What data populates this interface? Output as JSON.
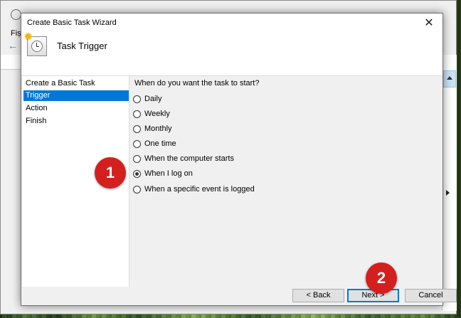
{
  "background_window": {
    "menu_label": "Fiș"
  },
  "dialog": {
    "title": "Create Basic Task Wizard",
    "close_icon": "close-icon",
    "header_title": "Task Trigger",
    "header_icon": "scheduled-task-clock-icon"
  },
  "steps": [
    {
      "label": "Create a Basic Task",
      "active": false
    },
    {
      "label": "Trigger",
      "active": true
    },
    {
      "label": "Action",
      "active": false
    },
    {
      "label": "Finish",
      "active": false
    }
  ],
  "question": "When do you want the task to start?",
  "options": [
    {
      "label": "Daily",
      "checked": false
    },
    {
      "label": "Weekly",
      "checked": false
    },
    {
      "label": "Monthly",
      "checked": false
    },
    {
      "label": "One time",
      "checked": false
    },
    {
      "label": "When the computer starts",
      "checked": false
    },
    {
      "label": "When I log on",
      "checked": true
    },
    {
      "label": "When a specific event is logged",
      "checked": false
    }
  ],
  "buttons": {
    "back": "< Back",
    "next": "Next >",
    "cancel": "Cancel"
  },
  "markers": {
    "one": "1",
    "two": "2"
  },
  "colors": {
    "accent": "#0078d7",
    "marker": "#d41f1f"
  }
}
